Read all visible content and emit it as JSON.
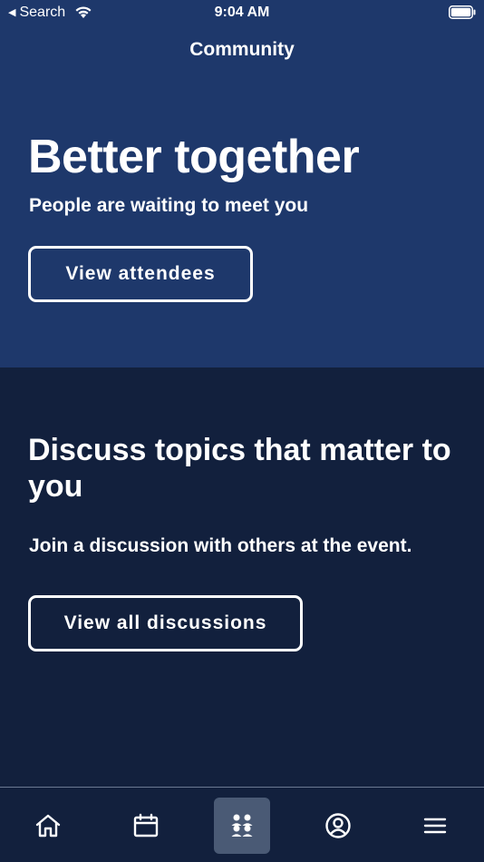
{
  "status_bar": {
    "back_label": "Search",
    "time": "9:04 AM"
  },
  "nav": {
    "title": "Community"
  },
  "hero": {
    "title": "Better together",
    "subtitle": "People are waiting to meet you",
    "button_label": "View attendees"
  },
  "discussions": {
    "title": "Discuss topics that matter to you",
    "subtitle": "Join a discussion with others at the event.",
    "button_label": "View all discussions"
  },
  "tab_bar": {
    "tabs": [
      {
        "icon": "home-icon",
        "active": false
      },
      {
        "icon": "calendar-icon",
        "active": false
      },
      {
        "icon": "community-icon",
        "active": true
      },
      {
        "icon": "profile-icon",
        "active": false
      },
      {
        "icon": "menu-icon",
        "active": false
      }
    ]
  },
  "colors": {
    "hero_background": "#1e386b",
    "page_background": "#12203d",
    "active_tab": "#4a5a75",
    "text": "#ffffff"
  }
}
